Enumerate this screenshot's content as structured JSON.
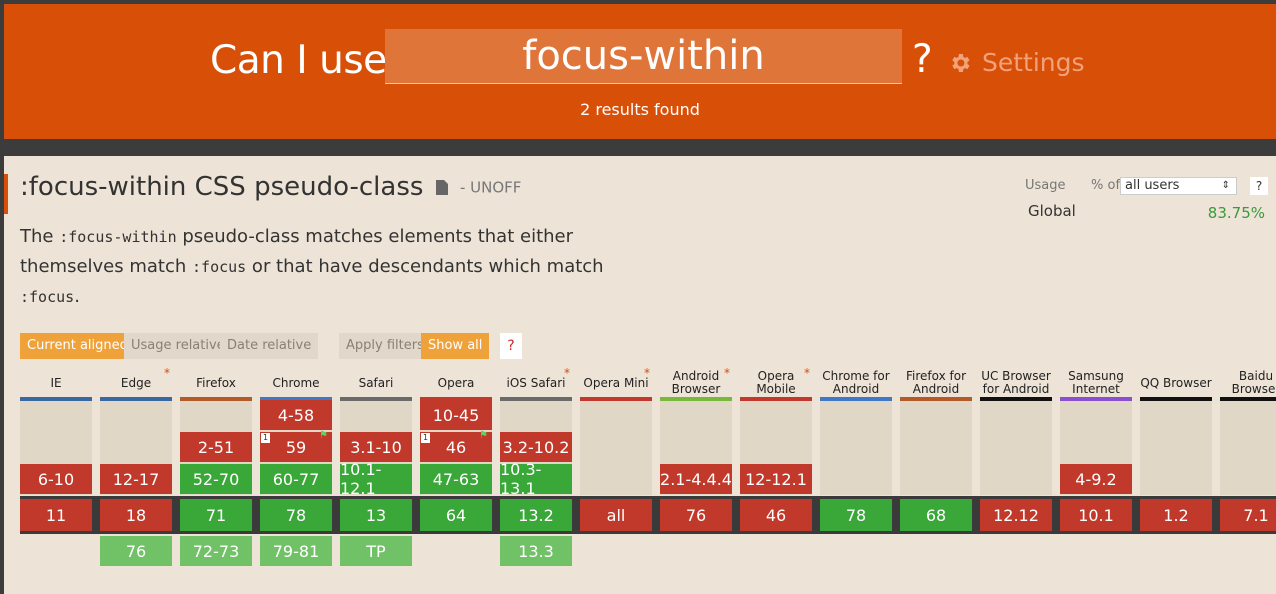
{
  "header": {
    "brand": "Can I use",
    "search_value": "focus-within",
    "help_label": "?",
    "settings_label": "Settings",
    "results": "2 results found",
    "color": "#d84f08"
  },
  "feature": {
    "title": ":focus-within CSS pseudo-class",
    "status": "- UNOFF",
    "desc": {
      "p1": "The ",
      "c1": ":focus-within",
      "p2": " pseudo-class matches elements that either themselves match ",
      "c2": ":focus",
      "p3": " or that have descendants which match ",
      "c3": ":focus",
      "p4": "."
    }
  },
  "usage": {
    "label": "Usage",
    "pct_of": "% of",
    "select_value": "all users",
    "help": "?",
    "region": "Global",
    "percent": "83.75%"
  },
  "filters": {
    "current_aligned": "Current aligned",
    "usage_relative": "Usage relative",
    "date_relative": "Date relative",
    "apply_filters": "Apply filters",
    "show_all": "Show all",
    "help": "?"
  },
  "colors": {
    "unsupported": "#c0392b",
    "supported": "#39a839",
    "future": "#71c267"
  },
  "browsers": [
    {
      "name": "IE",
      "asterisk": false,
      "bar": "#3a68a0",
      "cells": [
        [
          "6-10",
          "n"
        ]
      ],
      "current": "11",
      "cur_s": "n",
      "future": []
    },
    {
      "name": "Edge",
      "asterisk": true,
      "bar": "#3a68a0",
      "cells": [
        [
          "12-17",
          "n"
        ]
      ],
      "current": "18",
      "cur_s": "n",
      "future": [
        "76"
      ]
    },
    {
      "name": "Firefox",
      "asterisk": false,
      "bar": "#b45a2a",
      "cells": [
        [
          "2-51",
          "n"
        ],
        [
          "52-70",
          "y"
        ]
      ],
      "current": "71",
      "cur_s": "y",
      "future": [
        "72-73"
      ]
    },
    {
      "name": "Chrome",
      "asterisk": false,
      "bar": "#3f78c6",
      "cells": [
        [
          "4-58",
          "n"
        ],
        [
          "59",
          "n"
        ],
        [
          "60-77",
          "y"
        ]
      ],
      "current": "78",
      "cur_s": "y",
      "future": [
        "79-81"
      ]
    },
    {
      "name": "Safari",
      "asterisk": false,
      "bar": "#6a6a6a",
      "cells": [
        [
          "3.1-10",
          "n"
        ],
        [
          "10.1-12.1",
          "y"
        ]
      ],
      "current": "13",
      "cur_s": "y",
      "future": [
        "TP"
      ]
    },
    {
      "name": "Opera",
      "asterisk": false,
      "bar": "#c0392b",
      "cells": [
        [
          "10-45",
          "n"
        ],
        [
          "46",
          "n"
        ],
        [
          "47-63",
          "y"
        ]
      ],
      "current": "64",
      "cur_s": "y",
      "future": []
    },
    {
      "name": "iOS Safari",
      "asterisk": true,
      "bar": "#6a6a6a",
      "cells": [
        [
          "3.2-10.2",
          "n"
        ],
        [
          "10.3-13.1",
          "y"
        ]
      ],
      "current": "13.2",
      "cur_s": "y",
      "future": [
        "13.3"
      ]
    },
    {
      "name": "Opera Mini",
      "asterisk": true,
      "bar": "#c0392b",
      "cells": [],
      "current": "all",
      "cur_s": "n",
      "future": []
    },
    {
      "name": "Android Browser",
      "asterisk": true,
      "bar": "#78b83a",
      "cells": [
        [
          "2.1-4.4.4",
          "n"
        ]
      ],
      "current": "76",
      "cur_s": "n",
      "future": []
    },
    {
      "name": "Opera Mobile",
      "asterisk": true,
      "bar": "#c0392b",
      "cells": [
        [
          "12-12.1",
          "n"
        ]
      ],
      "current": "46",
      "cur_s": "n",
      "future": []
    },
    {
      "name": "Chrome for Android",
      "asterisk": false,
      "bar": "#3f78c6",
      "cells": [],
      "current": "78",
      "cur_s": "y",
      "future": []
    },
    {
      "name": "Firefox for Android",
      "asterisk": false,
      "bar": "#b45a2a",
      "cells": [],
      "current": "68",
      "cur_s": "y",
      "future": []
    },
    {
      "name": "UC Browser for Android",
      "asterisk": false,
      "bar": "#111111",
      "cells": [],
      "current": "12.12",
      "cur_s": "n",
      "future": []
    },
    {
      "name": "Samsung Internet",
      "asterisk": false,
      "bar": "#8a4fd0",
      "cells": [
        [
          "4-9.2",
          "n"
        ]
      ],
      "current": "10.1",
      "cur_s": "n",
      "future": []
    },
    {
      "name": "QQ Browser",
      "asterisk": false,
      "bar": "#111111",
      "cells": [],
      "current": "1.2",
      "cur_s": "n",
      "future": []
    },
    {
      "name": "Baidu Browser",
      "asterisk": false,
      "bar": "#111111",
      "cells": [],
      "current": "7.1",
      "cur_s": "n",
      "future": []
    }
  ],
  "notes": {
    "badge": "1",
    "flag": "⚑"
  }
}
